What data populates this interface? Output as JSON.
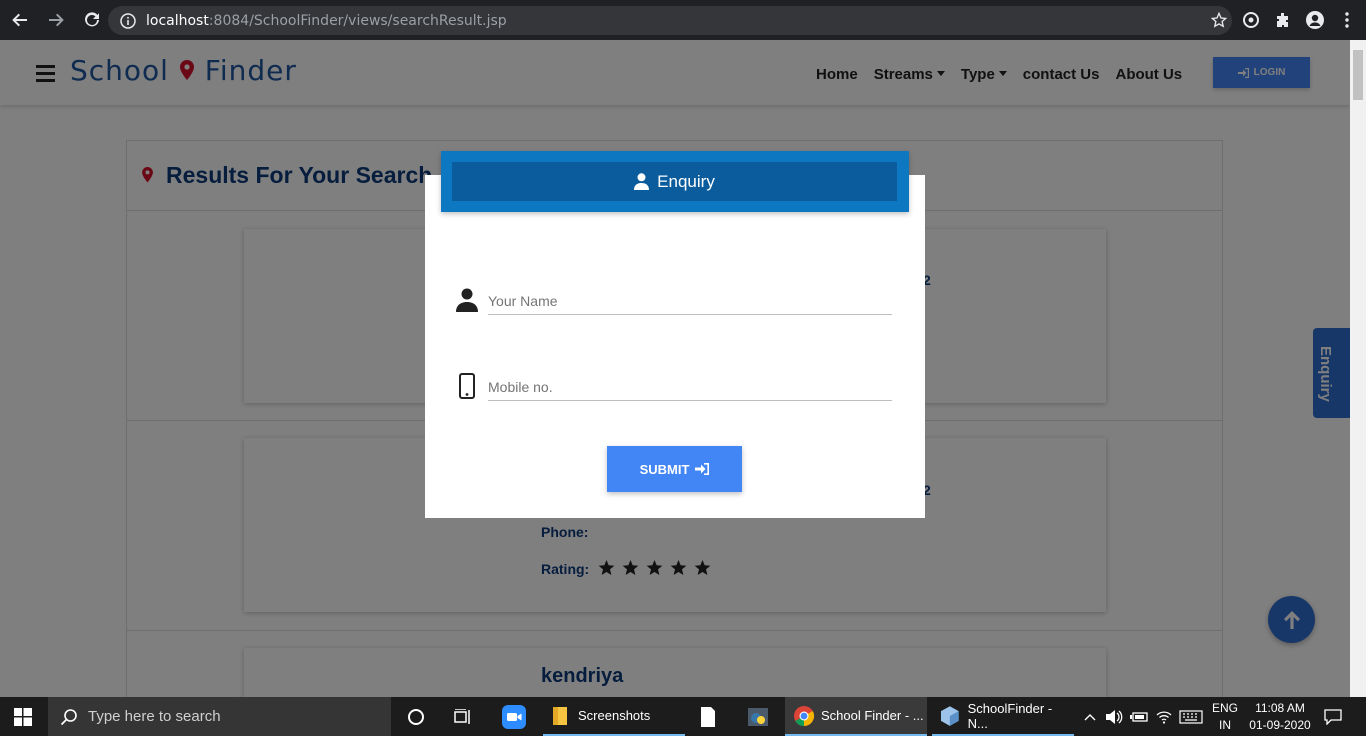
{
  "browser": {
    "url_host": "localhost",
    "url_path": ":8084/SchoolFinder/views/searchResult.jsp"
  },
  "site": {
    "logo_left": "School",
    "logo_right": "Finder",
    "menu": {
      "home": "Home",
      "streams": "Streams",
      "type": "Type",
      "contact": "contact Us",
      "about": "About Us"
    },
    "login_label": "LOGIN",
    "results_title": "Results For Your Search",
    "cards": {
      "phone_label": "Phone:",
      "rating_label": "Rating:",
      "rating_stars": 5,
      "partial_number": "2",
      "third_school_name": "kendriya"
    },
    "side_enquiry_label": "Enquiry"
  },
  "modal": {
    "title": "Enquiry",
    "name_placeholder": "Your Name",
    "mobile_placeholder": "Mobile no.",
    "submit_label": "SUBMIT"
  },
  "taskbar": {
    "search_placeholder": "Type here to search",
    "apps": {
      "screenshots": "Screenshots",
      "chrome": "School Finder - ...",
      "netbeans": "SchoolFinder - N..."
    },
    "lang_top": "ENG",
    "lang_bottom": "IN",
    "time": "11:08 AM",
    "date": "01-09-2020"
  },
  "colors": {
    "brand_blue": "#1e56a0",
    "primary_button": "#4285f4",
    "modal_header": "#0e77c2"
  }
}
